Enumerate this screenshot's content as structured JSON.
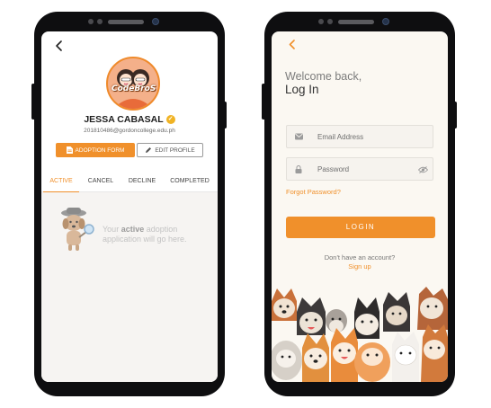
{
  "profile_screen": {
    "avatar_text": "CodeBroS",
    "name": "JESSA CABASAL",
    "email": "201810486@gordoncollege.edu.ph",
    "adoption_form_label": "ADOPTION FORM",
    "edit_profile_label": "EDIT PROFILE",
    "tabs": [
      {
        "label": "ACTIVE"
      },
      {
        "label": "CANCEL"
      },
      {
        "label": "DECLINE"
      },
      {
        "label": "COMPLETED"
      }
    ],
    "empty_message": {
      "before": "Your",
      "emphasis": "active",
      "after": "adoption application will go here."
    }
  },
  "login_screen": {
    "welcome": "Welcome back,",
    "title": "Log In",
    "email_placeholder": "Email Address",
    "password_placeholder": "Password",
    "forgot_password": "Forgot Password?",
    "login_button": "LOGIN",
    "no_account": "Don't have an account?",
    "sign_up": "Sign up"
  },
  "colors": {
    "accent": "#f0902b",
    "phone_frame": "#0e0e10",
    "verified_badge": "#f0b324"
  },
  "icons": [
    "back-arrow-icon",
    "verified-icon",
    "document-icon",
    "pencil-icon",
    "detective-dog-illustration",
    "email-icon",
    "lock-icon",
    "eye-off-icon",
    "dogs-illustration"
  ]
}
